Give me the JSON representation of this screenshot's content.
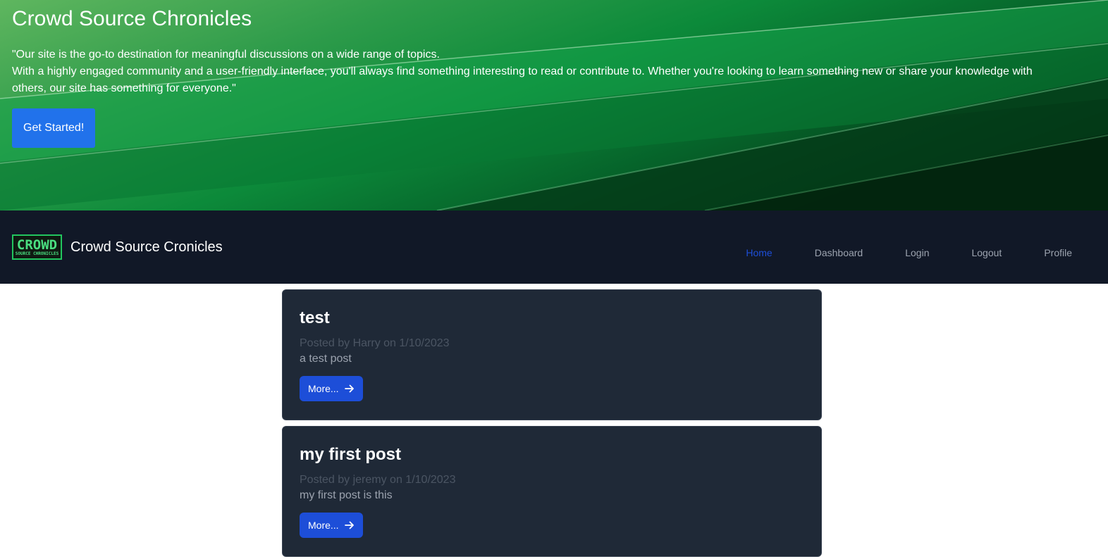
{
  "hero": {
    "title": "Crowd Source Chronicles",
    "line1": "\"Our site is the go-to destination for meaningful discussions on a wide range of topics.",
    "line2": "With a highly engaged community and a user-friendly interface, you'll always find something interesting to read or contribute to. Whether you're looking to learn something new or share your knowledge with others, our site has something for everyone.\"",
    "button_label": "Get Started!"
  },
  "navbar": {
    "logo_big": "CROWD",
    "logo_small": "SOURCE CHRONICLES",
    "brand_name": "Crowd Source Cronicles",
    "links": [
      {
        "label": "Home"
      },
      {
        "label": "Dashboard"
      },
      {
        "label": "Login"
      },
      {
        "label": "Logout"
      },
      {
        "label": "Profile"
      }
    ],
    "active": "Home"
  },
  "posts": [
    {
      "title": "test",
      "meta": "Posted by Harry on 1/10/2023",
      "body": "a test post",
      "button_label": "More..."
    },
    {
      "title": "my first post",
      "meta": "Posted by jeremy on 1/10/2023",
      "body": "my first post is this",
      "button_label": "More..."
    }
  ],
  "colors": {
    "primary_button": "#2172eb",
    "nav_bg": "#111827",
    "card_bg": "#1f2937",
    "active_link": "#1d4ed8"
  },
  "icons": {
    "more_button": "arrow-right-icon",
    "logo": "crowd-source-logo"
  }
}
